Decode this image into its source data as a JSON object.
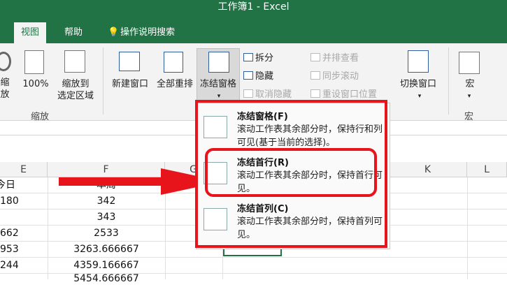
{
  "title_bar": {
    "title": "工作簿1  -  Excel"
  },
  "tabs": [
    {
      "label": "视图"
    },
    {
      "label": "帮助"
    },
    {
      "label": "操作说明搜索"
    }
  ],
  "ribbon": {
    "zoom_group": {
      "partial_button": "缩\n放",
      "zoom100": "100%",
      "zoom_selection": "缩放到\n选定区域",
      "group_label": "缩放"
    },
    "window_group": {
      "new_window": "新建窗口",
      "arrange_all": "全部重排",
      "freeze_panes": "冻结窗格",
      "split": "拆分",
      "hide": "隐藏",
      "unhide": "取消隐藏",
      "view_side_by_side": "并排查看",
      "sync_scroll": "同步滚动",
      "reset_position": "重设窗口位置",
      "switch_windows": "切换窗口"
    },
    "macro_group": {
      "macros": "宏",
      "group_label": "宏"
    }
  },
  "grid": {
    "column_headers": [
      "E",
      "F",
      "G",
      "K",
      "L"
    ],
    "col_e_values": [
      "今日",
      "180",
      "662",
      "953",
      "244"
    ],
    "col_f_values": [
      "本周",
      "342",
      "343",
      "2533",
      "3263.666667",
      "4359.166667",
      "5454.666667"
    ]
  },
  "freeze_menu": {
    "items": [
      {
        "title": "冻结窗格(F)",
        "desc": "滚动工作表其余部分时，保持行和列可见(基于当前的选择)。"
      },
      {
        "title": "冻结首行(R)",
        "desc": "滚动工作表其余部分时，保持首行可见。"
      },
      {
        "title": "冻结首列(C)",
        "desc": "滚动工作表其余部分时，保持首列可见。"
      }
    ]
  },
  "colors": {
    "excel_green": "#217346",
    "highlight_red": "#e8141b"
  },
  "icons": [
    "bulb-icon",
    "magnifier-icon",
    "zoom100-icon",
    "zoom-selection-icon",
    "new-window-icon",
    "arrange-all-icon",
    "freeze-panes-icon",
    "switch-windows-icon",
    "macro-icon",
    "arrow-icon"
  ]
}
